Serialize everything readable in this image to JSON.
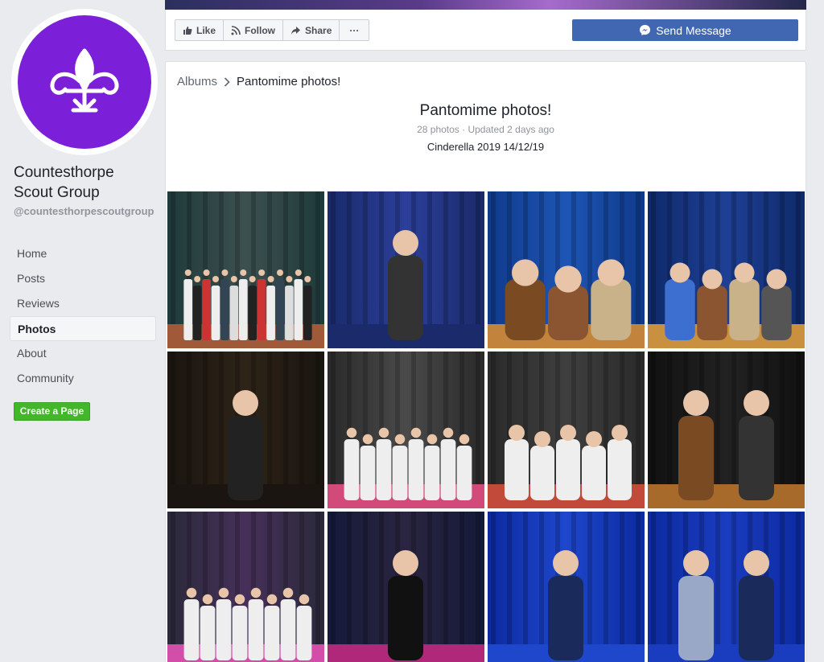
{
  "sidebar": {
    "page_name": "Countesthorpe Scout Group",
    "handle": "@countesthorpescoutgroup",
    "nav": [
      "Home",
      "Posts",
      "Reviews",
      "Photos",
      "About",
      "Community"
    ],
    "active": "Photos",
    "create_page": "Create a Page"
  },
  "actions": {
    "like": "Like",
    "follow": "Follow",
    "share": "Share",
    "more": "···",
    "send_message": "Send Message"
  },
  "album": {
    "breadcrumb_root": "Albums",
    "breadcrumb_current": "Pantomime photos!",
    "title": "Pantomime photos!",
    "meta": "28 photos · Updated 2 days ago",
    "description": "Cinderella 2019 14/12/19"
  },
  "colors": {
    "brand_purple": "#7c1fd9",
    "facebook_blue": "#4267b2",
    "create_green": "#42b72a"
  },
  "photos": [
    {
      "name": "photo-group-cast",
      "scene": "cast"
    },
    {
      "name": "photo-narrator-reading",
      "scene": "reader"
    },
    {
      "name": "photo-bear-costumes",
      "scene": "bears"
    },
    {
      "name": "photo-bears-audience",
      "scene": "bears2"
    },
    {
      "name": "photo-singer-microphone",
      "scene": "singer"
    },
    {
      "name": "photo-letters-kids-tables",
      "scene": "letters"
    },
    {
      "name": "photo-idea-kids",
      "scene": "idea"
    },
    {
      "name": "photo-bear-behind-curtain",
      "scene": "curtainbear"
    },
    {
      "name": "photo-cinderella-letters",
      "scene": "cinderella"
    },
    {
      "name": "photo-villain-on-stage",
      "scene": "villain"
    },
    {
      "name": "photo-prince-singing",
      "scene": "prince"
    },
    {
      "name": "photo-cinderella-and-prince",
      "scene": "duet"
    }
  ]
}
